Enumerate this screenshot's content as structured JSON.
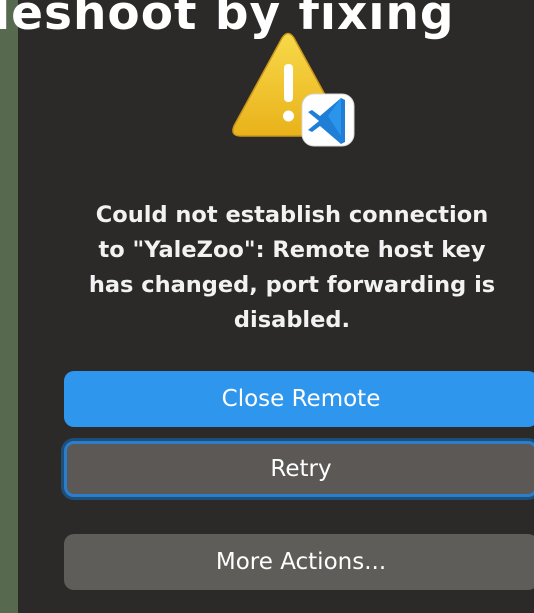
{
  "overlay": {
    "caption": "leshoot by fixing"
  },
  "dialog": {
    "message": "Could not establish connection to \"YaleZoo\": Remote host key has changed, port forwarding is disabled.",
    "message_lines": [
      "Could not establish connection",
      "to \"YaleZoo\": Remote host key",
      "has changed, port forwarding is",
      "disabled."
    ],
    "buttons": {
      "close_remote": "Close Remote",
      "retry": "Retry",
      "more_actions": "More Actions..."
    }
  },
  "icons": {
    "warning": "warning-triangle-icon",
    "app": "vscode-icon"
  },
  "colors": {
    "primary": "#2f96ee",
    "focus_ring": "#2a7ecb",
    "warning_yellow": "#f3c631"
  }
}
